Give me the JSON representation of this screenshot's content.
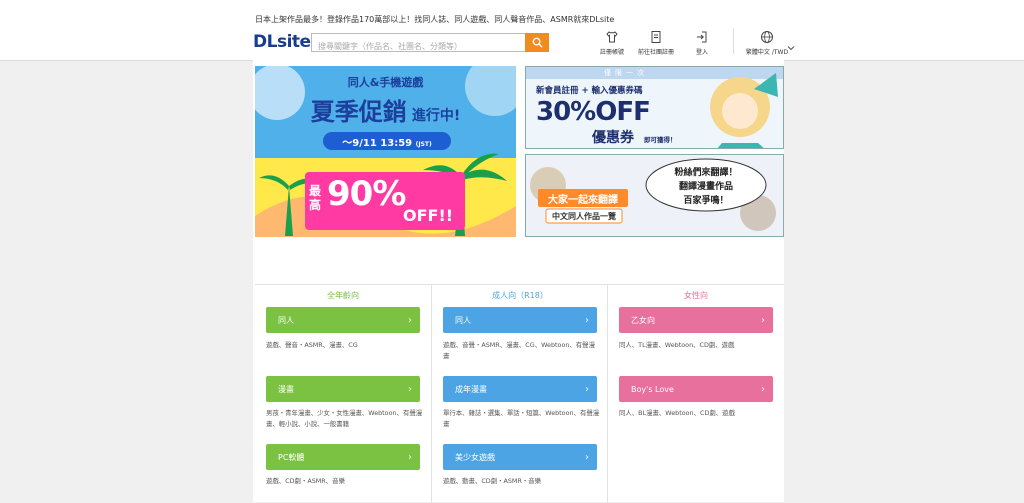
{
  "header": {
    "tagline": "日本上架作品最多！登錄作品170萬部以上！找同人誌、同人遊戲、同人聲音作品、ASMR就來DLsite",
    "logo_text": "DLsite",
    "search": {
      "placeholder": "搜尋關鍵字（作品名、社團名、分類等）",
      "value": ""
    },
    "nav": [
      {
        "icon": "shirt-icon",
        "label": "註冊帳號"
      },
      {
        "icon": "book-icon",
        "label": "前往社團註冊"
      },
      {
        "icon": "login-icon",
        "label": "登入"
      }
    ],
    "language": {
      "icon": "globe-icon",
      "label": "繁體中文 /TWD"
    }
  },
  "banners": {
    "summer_sale": {
      "subtitle": "同人&手機遊戲",
      "title": "夏季促銷",
      "title_suffix": "進行中!",
      "date": "～9/11 13:59",
      "tz": "(JST)",
      "max_label": "最高",
      "discount": "90%",
      "off": "OFF!!"
    },
    "coupon": {
      "top_label": "僅限一次",
      "line": "新會員註冊 + 輸入優惠券碼",
      "discount": "30%OFF",
      "coupon_word": "優惠券",
      "get_now": "即可獲得！"
    },
    "translate": {
      "title": "大家一起來翻譯",
      "subtitle": "中文同人作品一覽",
      "bubble1": "粉絲們來翻譯！",
      "bubble2": "翻譯漫畫作品",
      "bubble3": "百家爭鳴！"
    }
  },
  "categories": [
    {
      "title": "全年齡向",
      "color": "#7cc242",
      "items": [
        {
          "label": "同人",
          "desc": "遊戲、聲音・ASMR、漫畫、CG"
        },
        {
          "label": "漫畫",
          "desc": "男孩・青年漫畫、少女・女性漫畫、Webtoon、有聲漫畫、輕小說、小說、一般書籍"
        },
        {
          "label": "PC軟體",
          "desc": "遊戲、CD劇・ASMR、音樂"
        }
      ]
    },
    {
      "title": "成人向（R18）",
      "color": "#4da4e4",
      "items": [
        {
          "label": "同人",
          "desc": "遊戲、音聲・ASMR、漫畫、CG、Webtoon、有聲漫畫"
        },
        {
          "label": "成年漫畫",
          "desc": "單行本、雜誌・選集、單話・短篇、Webtoon、有聲漫畫"
        },
        {
          "label": "美少女遊戲",
          "desc": "遊戲、動畫、CD劇・ASMR・音樂"
        }
      ]
    },
    {
      "title": "女性向",
      "color": "#e8709d",
      "items": [
        {
          "label": "乙女向",
          "desc": "同人、TL漫畫、Webtoon、CD劇、遊戲"
        },
        {
          "label": "Boy's Love",
          "desc": "同人、BL漫畫、Webtoon、CD劇、遊戲"
        }
      ]
    }
  ]
}
